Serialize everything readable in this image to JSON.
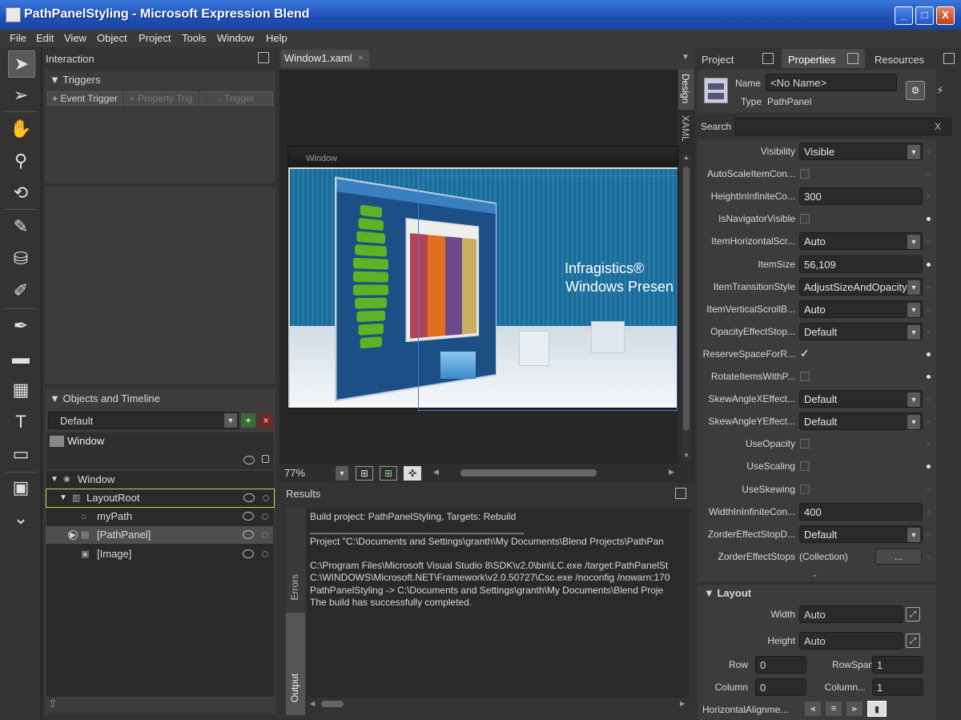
{
  "window": {
    "title": "PathPanelStyling - Microsoft Expression Blend",
    "min": "_",
    "max": "□",
    "close": "X"
  },
  "menu": [
    "File",
    "Edit",
    "View",
    "Object",
    "Project",
    "Tools",
    "Window",
    "Help"
  ],
  "interaction": {
    "title": "Interaction",
    "triggers_header": "▼ Triggers",
    "event_trigger": "+ Event Trigger",
    "property_trigger": "+ Property Trig",
    "remove_trigger": "- Trigger"
  },
  "objects": {
    "header": "▼ Objects and Timeline",
    "timeline": "Default",
    "scope": "Window",
    "tree": [
      {
        "label": "Window",
        "indent": 0,
        "prefix": "▼"
      },
      {
        "label": "LayoutRoot",
        "indent": 1,
        "prefix": "▼"
      },
      {
        "label": "myPath",
        "indent": 2,
        "prefix": ""
      },
      {
        "label": "[PathPanel]",
        "indent": 2,
        "prefix": "▶"
      },
      {
        "label": "[Image]",
        "indent": 2,
        "prefix": ""
      }
    ]
  },
  "document": {
    "tab": "Window1.xaml",
    "tab_close": "×",
    "side_tabs": [
      "Design",
      "XAML"
    ],
    "window_label": "Window",
    "canvas_text_1": "Infragistics®",
    "canvas_text_2": "Windows Presen",
    "zoom": "77%"
  },
  "results": {
    "title": "Results",
    "side_tabs": [
      "Errors",
      "Output"
    ],
    "lines": [
      "Build project: PathPanelStyling, Targets: Rebuild",
      "________________________________________",
      "Project \"C:\\Documents and Settings\\granth\\My Documents\\Blend Projects\\PathPan",
      "",
      "C:\\Program Files\\Microsoft Visual Studio 8\\SDK\\v2.0\\bin\\LC.exe /target:PathPanelSt",
      "C:\\WINDOWS\\Microsoft.NET\\Framework\\v2.0.50727\\Csc.exe /noconfig /nowarn:170",
      "PathPanelStyling -> C:\\Documents and Settings\\granth\\My Documents\\Blend Proje",
      "The build has successfully completed."
    ]
  },
  "right_tabs": [
    "Project",
    "Properties",
    "Resources"
  ],
  "properties": {
    "name_label": "Name",
    "name_value": "<No Name>",
    "type_label": "Type",
    "type_value": "PathPanel",
    "search_label": "Search",
    "search_clear": "X",
    "rows": [
      {
        "label": "Visibility",
        "kind": "dropdown",
        "value": "Visible",
        "dot": false
      },
      {
        "label": "AutoScaleItemCon...",
        "kind": "check",
        "value": "",
        "dot": false
      },
      {
        "label": "HeightInInfiniteCo...",
        "kind": "text",
        "value": "300",
        "dot": false
      },
      {
        "label": "IsNavigatorVisible",
        "kind": "check",
        "value": "",
        "dot": true
      },
      {
        "label": "ItemHorizontalScr...",
        "kind": "dropdown",
        "value": "Auto",
        "dot": false
      },
      {
        "label": "ItemSize",
        "kind": "text",
        "value": "56,109",
        "dot": true
      },
      {
        "label": "ItemTransitionStyle",
        "kind": "dropdown",
        "value": "AdjustSizeAndOpacity",
        "dot": false
      },
      {
        "label": "ItemVerticalScrollB...",
        "kind": "dropdown",
        "value": "Auto",
        "dot": false
      },
      {
        "label": "OpacityEffectStop...",
        "kind": "dropdown",
        "value": "Default",
        "dot": false
      },
      {
        "label": "ReserveSpaceForR...",
        "kind": "checked",
        "value": "✓",
        "dot": true
      },
      {
        "label": "RotateItemsWithP...",
        "kind": "check",
        "value": "",
        "dot": true
      },
      {
        "label": "SkewAngleXEffect...",
        "kind": "dropdown",
        "value": "Default",
        "dot": false
      },
      {
        "label": "SkewAngleYEffect...",
        "kind": "dropdown",
        "value": "Default",
        "dot": false
      },
      {
        "label": "UseOpacity",
        "kind": "check",
        "value": "",
        "dot": false
      },
      {
        "label": "UseScaling",
        "kind": "check",
        "value": "",
        "dot": true
      },
      {
        "label": "UseSkewing",
        "kind": "check",
        "value": "",
        "dot": false
      },
      {
        "label": "WidthInInfiniteCon...",
        "kind": "text",
        "value": "400",
        "dot": false
      },
      {
        "label": "ZorderEffectStopD...",
        "kind": "dropdown",
        "value": "Default",
        "dot": false
      },
      {
        "label": "ZorderEffectStops",
        "kind": "collection",
        "value": "(Collection)",
        "dot": false
      }
    ],
    "collection_btn": "...",
    "layout_header": "▼ Layout",
    "width_label": "Width",
    "width_value": "Auto",
    "height_label": "Height",
    "height_value": "Auto",
    "row_label": "Row",
    "row_value": "0",
    "rowspan_label": "RowSpan",
    "rowspan_value": "1",
    "column_label": "Column",
    "column_value": "0",
    "columnspan_label": "Column...",
    "columnspan_value": "1",
    "halign_label": "HorizontalAlignme..."
  },
  "colors": {
    "title_bar": "#2558c8",
    "panel": "#3c3c3c",
    "selection_outline": "#e0e020",
    "canvas_blue": "#1f6fa0",
    "button_green": "#58b020"
  }
}
